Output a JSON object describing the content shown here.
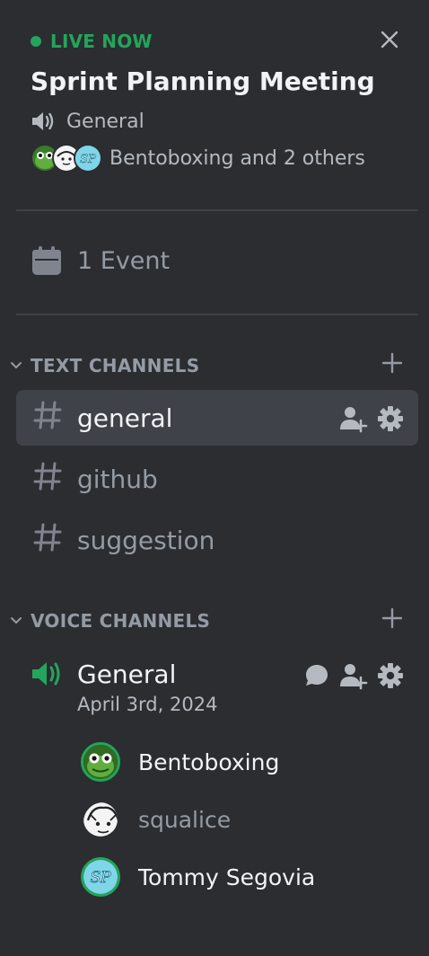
{
  "live_card": {
    "status": "LIVE NOW",
    "title": "Sprint Planning Meeting",
    "location": "General",
    "attendees_text": "Bentoboxing and 2 others",
    "accent_color": "#23a55a"
  },
  "events": {
    "label": "1 Event"
  },
  "text_category": {
    "label": "TEXT CHANNELS"
  },
  "text_channels": [
    {
      "name": "general"
    },
    {
      "name": "github"
    },
    {
      "name": "suggestion"
    }
  ],
  "voice_category": {
    "label": "VOICE CHANNELS"
  },
  "voice_channel": {
    "name": "General",
    "date": "April 3rd, 2024"
  },
  "voice_members": [
    {
      "name": "Bentoboxing"
    },
    {
      "name": "squalice"
    },
    {
      "name": "Tommy Segovia"
    }
  ]
}
